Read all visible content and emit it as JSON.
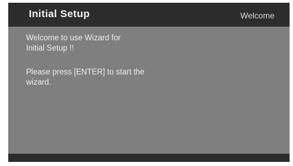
{
  "header": {
    "title": "Initial Setup",
    "subtitle": "Welcome"
  },
  "main": {
    "welcome_message": "Welcome to use Wizard for\nInitial Setup !!",
    "instruction_message": "Please press [ENTER] to start the\nwizard."
  },
  "colors": {
    "frame": "#2c2c2c",
    "content_background": "#7f7f7f",
    "title_text": "#f2f2f2",
    "body_text": "#efefef"
  }
}
